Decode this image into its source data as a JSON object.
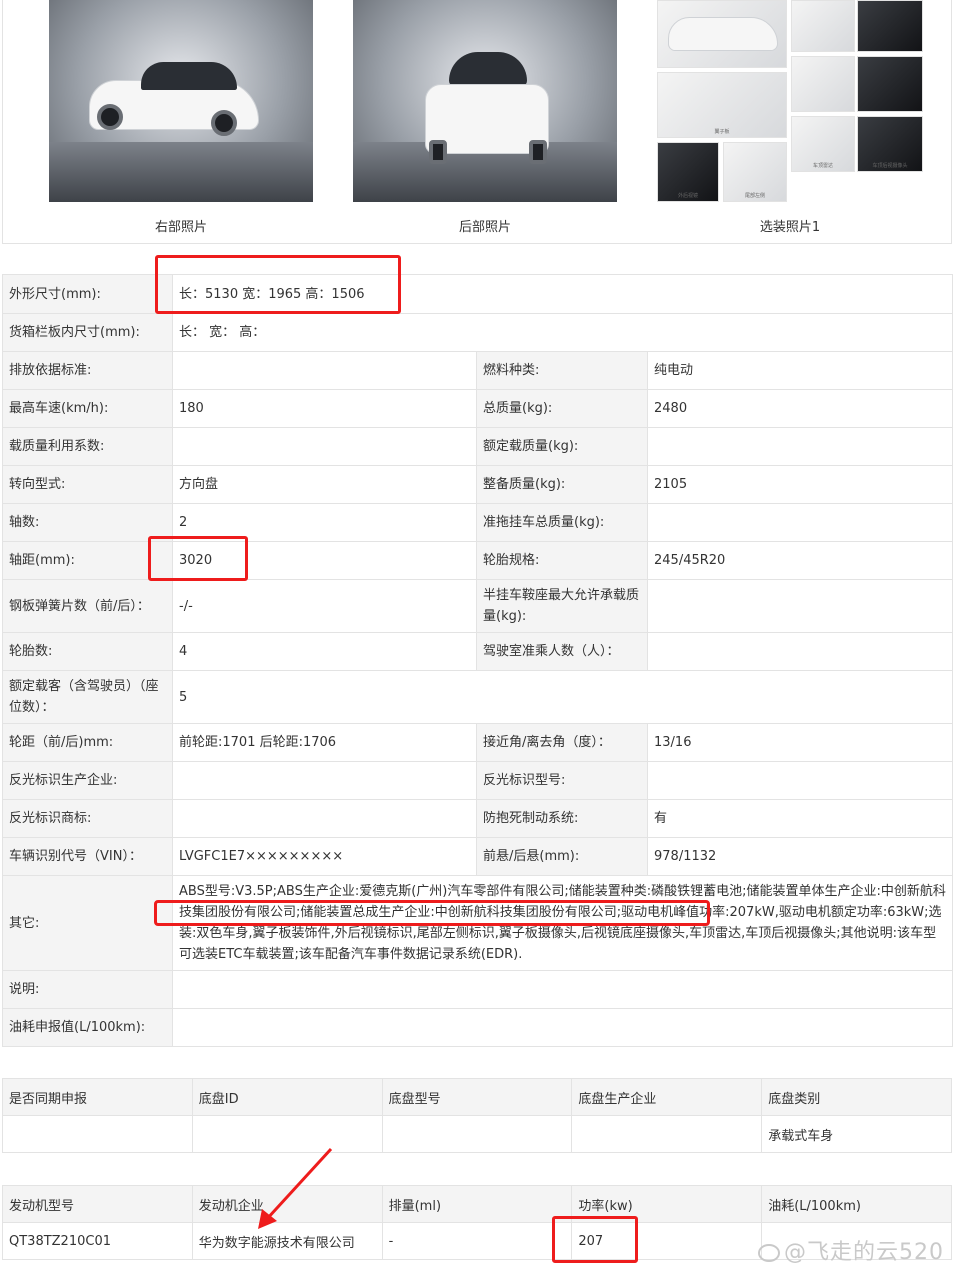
{
  "photos": [
    {
      "caption": "右部照片"
    },
    {
      "caption": "后部照片"
    },
    {
      "caption": "选装照片1"
    }
  ],
  "spec": {
    "rows": [
      {
        "label": "外形尺寸(mm):",
        "value": "长：5130 宽：1965 高：1506"
      },
      {
        "label": "货箱栏板内尺寸(mm):",
        "value": "长：  宽：  高："
      },
      {
        "label": "排放依据标准:",
        "value": "",
        "label2": "燃料种类:",
        "value2": "纯电动"
      },
      {
        "label": "最高车速(km/h):",
        "value": "180",
        "label2": "总质量(kg):",
        "value2": "2480"
      },
      {
        "label": "载质量利用系数:",
        "value": "",
        "label2": "额定载质量(kg):",
        "value2": ""
      },
      {
        "label": "转向型式:",
        "value": "方向盘",
        "label2": "整备质量(kg):",
        "value2": "2105"
      },
      {
        "label": "轴数:",
        "value": "2",
        "label2": "准拖挂车总质量(kg):",
        "value2": ""
      },
      {
        "label": "轴距(mm):",
        "value": "3020",
        "label2": "轮胎规格:",
        "value2": "245/45R20"
      },
      {
        "label": "钢板弹簧片数（前/后）：",
        "value": "-/-",
        "label2": "半挂车鞍座最大允许承载质量(kg):",
        "value2": ""
      },
      {
        "label": "轮胎数:",
        "value": "4",
        "label2": "驾驶室准乘人数（人）：",
        "value2": ""
      },
      {
        "label": "额定载客（含驾驶员）（座位数）：",
        "value": "5"
      },
      {
        "label": "轮距（前/后)mm:",
        "value": "前轮距:1701 后轮距:1706",
        "label2": "接近角/离去角（度）：",
        "value2": "13/16"
      },
      {
        "label": "反光标识生产企业:",
        "value": "",
        "label2": "反光标识型号:",
        "value2": ""
      },
      {
        "label": "反光标识商标:",
        "value": "",
        "label2": "防抱死制动系统:",
        "value2": "有"
      },
      {
        "label": "车辆识别代号（VIN）：",
        "value": "LVGFC1E7×××××××××",
        "label2": "前悬/后悬(mm):",
        "value2": "978/1132"
      },
      {
        "label": "其它:",
        "value": "ABS型号:V3.5P;ABS生产企业:爱德克斯(广州)汽车零部件有限公司;储能装置种类:磷酸铁锂蓄电池;储能装置单体生产企业:中创新航科技集团股份有限公司;储能装置总成生产企业:中创新航科技集团股份有限公司;驱动电机峰值功率:207kW,驱动电机额定功率:63kW;选装:双色车身,翼子板装饰件,外后视镜标识,尾部左侧标识,翼子板摄像头,后视镜底座摄像头,车顶雷达,车顶后视摄像头;其他说明:该车型可选装ETC车载装置;该车配备汽车事件数据记录系统(EDR)."
      },
      {
        "label": "说明:",
        "value": ""
      },
      {
        "label": "油耗申报值(L/100km):",
        "value": ""
      }
    ]
  },
  "chassis": {
    "headers": [
      "是否同期申报",
      "底盘ID",
      "底盘型号",
      "底盘生产企业",
      "底盘类别"
    ],
    "row": [
      "",
      "",
      "",
      "",
      "承载式车身"
    ]
  },
  "engine": {
    "headers": [
      "发动机型号",
      "发动机企业",
      "排量(ml)",
      "功率(kw)",
      "油耗(L/100km)"
    ],
    "row": [
      "QT38TZ210C01",
      "华为数字能源技术有限公司",
      "-",
      "207",
      ""
    ]
  },
  "watermark": "@飞走的云520",
  "annotation_color": "#ee1c1c"
}
